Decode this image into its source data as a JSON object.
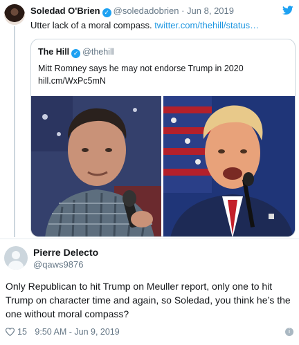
{
  "tweet": {
    "author_name": "Soledad O'Brien",
    "handle_date": "@soledadobrien · Jun 8, 2019",
    "text": "Utter lack of a moral compass.",
    "link_text": "twitter.com/thehill/status…",
    "verified_glyph": "✓",
    "icons": [
      "avatar",
      "verified-badge-icon",
      "twitter-bird-icon"
    ]
  },
  "quoted": {
    "author_name": "The Hill",
    "handle": "@thehill",
    "verified_glyph": "✓",
    "text": "Mitt Romney says he may not endorse Trump in 2020",
    "link": "hill.cm/WxPc5mN",
    "photos": [
      "romney-photo",
      "trump-photo"
    ]
  },
  "reply": {
    "author_name": "Pierre Delecto",
    "handle": "@qaws9876",
    "text": "Only Republican to hit Trump on Meuller report, only one to hit Trump on character time and again, so Soledad, you think he’s the one without moral compass?",
    "like_count": "15",
    "timestamp": "9:50 AM - Jun 9, 2019",
    "info_glyph": "i"
  },
  "colors": {
    "accent": "#1da1f2",
    "link": "#1b95e0",
    "muted": "#657786",
    "border": "#ccd6dd"
  }
}
